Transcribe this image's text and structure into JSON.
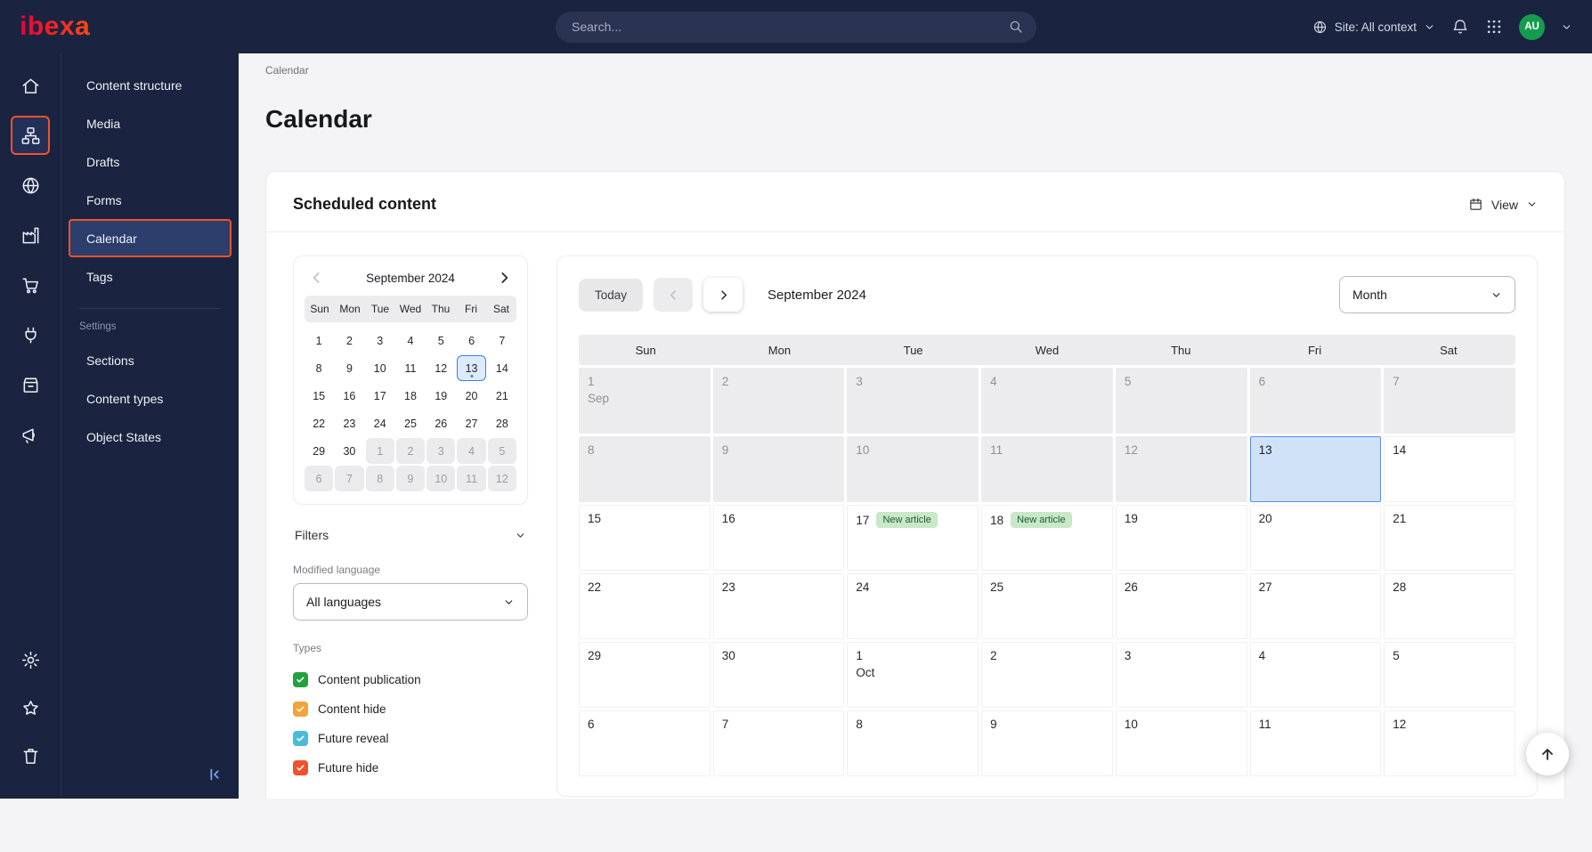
{
  "topbar": {
    "logo": "ibexa",
    "search_placeholder": "Search...",
    "site_context": "Site: All context",
    "avatar_initials": "AU"
  },
  "icon_rail": {
    "top": [
      {
        "name": "home",
        "icon": "home",
        "active": false
      },
      {
        "name": "content",
        "icon": "sitemap",
        "active": true
      },
      {
        "name": "site",
        "icon": "globe",
        "active": false
      },
      {
        "name": "company",
        "icon": "building",
        "active": false
      },
      {
        "name": "commerce",
        "icon": "cart",
        "active": false
      },
      {
        "name": "integrations",
        "icon": "plug",
        "active": false
      },
      {
        "name": "products",
        "icon": "shop",
        "active": false
      },
      {
        "name": "marketing",
        "icon": "megaphone",
        "active": false
      }
    ],
    "bottom": [
      {
        "name": "settings",
        "icon": "gear"
      },
      {
        "name": "bookmarks",
        "icon": "star"
      },
      {
        "name": "trash",
        "icon": "trash"
      }
    ]
  },
  "sidebar": {
    "items": [
      {
        "label": "Content structure",
        "active": false
      },
      {
        "label": "Media",
        "active": false
      },
      {
        "label": "Drafts",
        "active": false
      },
      {
        "label": "Forms",
        "active": false
      },
      {
        "label": "Calendar",
        "active": true
      },
      {
        "label": "Tags",
        "active": false
      }
    ],
    "settings_label": "Settings",
    "settings_items": [
      {
        "label": "Sections",
        "active": false
      },
      {
        "label": "Content types",
        "active": false
      },
      {
        "label": "Object States",
        "active": false
      }
    ]
  },
  "breadcrumb": "Calendar",
  "page_title": "Calendar",
  "scheduled": {
    "heading": "Scheduled content",
    "view_button": "View"
  },
  "mini_calendar": {
    "month_label": "September 2024",
    "weekdays": [
      "Sun",
      "Mon",
      "Tue",
      "Wed",
      "Thu",
      "Fri",
      "Sat"
    ],
    "weeks": [
      [
        {
          "d": 1
        },
        {
          "d": 2
        },
        {
          "d": 3
        },
        {
          "d": 4
        },
        {
          "d": 5
        },
        {
          "d": 6
        },
        {
          "d": 7
        }
      ],
      [
        {
          "d": 8
        },
        {
          "d": 9
        },
        {
          "d": 10
        },
        {
          "d": 11
        },
        {
          "d": 12
        },
        {
          "d": 13,
          "selected": true
        },
        {
          "d": 14
        }
      ],
      [
        {
          "d": 15
        },
        {
          "d": 16
        },
        {
          "d": 17
        },
        {
          "d": 18
        },
        {
          "d": 19
        },
        {
          "d": 20
        },
        {
          "d": 21
        }
      ],
      [
        {
          "d": 22
        },
        {
          "d": 23
        },
        {
          "d": 24
        },
        {
          "d": 25
        },
        {
          "d": 26
        },
        {
          "d": 27
        },
        {
          "d": 28
        }
      ],
      [
        {
          "d": 29
        },
        {
          "d": 30
        },
        {
          "d": 1,
          "muted": true
        },
        {
          "d": 2,
          "muted": true
        },
        {
          "d": 3,
          "muted": true
        },
        {
          "d": 4,
          "muted": true
        },
        {
          "d": 5,
          "muted": true
        }
      ],
      [
        {
          "d": 6,
          "muted": true
        },
        {
          "d": 7,
          "muted": true
        },
        {
          "d": 8,
          "muted": true
        },
        {
          "d": 9,
          "muted": true
        },
        {
          "d": 10,
          "muted": true
        },
        {
          "d": 11,
          "muted": true
        },
        {
          "d": 12,
          "muted": true
        }
      ]
    ]
  },
  "filters": {
    "label": "Filters",
    "modified_language_label": "Modified language",
    "language_value": "All languages",
    "types_label": "Types",
    "types": [
      {
        "label": "Content publication",
        "color": "#23a13f"
      },
      {
        "label": "Content hide",
        "color": "#f3a33a"
      },
      {
        "label": "Future reveal",
        "color": "#49bcd9"
      },
      {
        "label": "Future hide",
        "color": "#f1512e"
      }
    ]
  },
  "big_calendar": {
    "today_button": "Today",
    "month_label": "September  2024",
    "view_select": "Month",
    "weekdays": [
      "Sun",
      "Mon",
      "Tue",
      "Wed",
      "Thu",
      "Fri",
      "Sat"
    ],
    "event_color": "#c8e8c9",
    "event_text_color": "#1c5b2e",
    "weeks": [
      [
        {
          "d": 1,
          "sub": "Sep",
          "muted": true
        },
        {
          "d": 2,
          "muted": true
        },
        {
          "d": 3,
          "muted": true
        },
        {
          "d": 4,
          "muted": true
        },
        {
          "d": 5,
          "muted": true
        },
        {
          "d": 6,
          "muted": true
        },
        {
          "d": 7,
          "muted": true
        }
      ],
      [
        {
          "d": 8,
          "muted": true
        },
        {
          "d": 9,
          "muted": true
        },
        {
          "d": 10,
          "muted": true
        },
        {
          "d": 11,
          "muted": true
        },
        {
          "d": 12,
          "muted": true
        },
        {
          "d": 13,
          "today": true
        },
        {
          "d": 14
        }
      ],
      [
        {
          "d": 15
        },
        {
          "d": 16
        },
        {
          "d": 17,
          "event": "New article"
        },
        {
          "d": 18,
          "event": "New article"
        },
        {
          "d": 19
        },
        {
          "d": 20
        },
        {
          "d": 21
        }
      ],
      [
        {
          "d": 22
        },
        {
          "d": 23
        },
        {
          "d": 24
        },
        {
          "d": 25
        },
        {
          "d": 26
        },
        {
          "d": 27
        },
        {
          "d": 28
        }
      ],
      [
        {
          "d": 29
        },
        {
          "d": 30
        },
        {
          "d": 1,
          "sub": "Oct"
        },
        {
          "d": 2
        },
        {
          "d": 3
        },
        {
          "d": 4
        },
        {
          "d": 5
        }
      ],
      [
        {
          "d": 6
        },
        {
          "d": 7
        },
        {
          "d": 8
        },
        {
          "d": 9
        },
        {
          "d": 10
        },
        {
          "d": 11
        },
        {
          "d": 12
        }
      ]
    ]
  }
}
